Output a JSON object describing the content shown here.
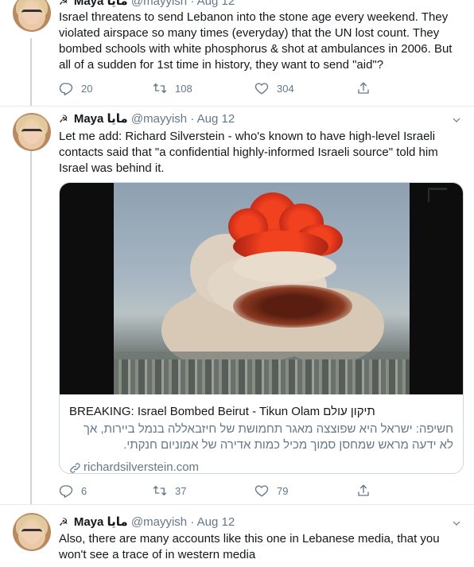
{
  "tweets": [
    {
      "flag": "☭",
      "display_name": "Maya مايا",
      "handle": "@mayyish",
      "separator": "·",
      "date": "Aug 12",
      "text": "Israel threatens to send Lebanon into the stone age every weekend. They violated airspace so many times (everyday) that the UN lost count. They bombed schools with white phosphorus & shot at ambulances in 2006. But all of a sudden for 1st time in history, they want to send \"aid\"?",
      "replies": "20",
      "retweets": "108",
      "likes": "304"
    },
    {
      "flag": "☭",
      "display_name": "Maya مايا",
      "handle": "@mayyish",
      "separator": "·",
      "date": "Aug 12",
      "text": "Let me add: Richard Silverstein - who's known to have high-level Israeli contacts said that  \"a confidential highly-informed Israeli source\" told him Israel was behind it.",
      "card": {
        "title": "BREAKING: Israel Bombed Beirut - Tikun Olam תיקון עולם",
        "description": "חשיפה: ישראל היא שפוצצה מאגר תחמושת של חיזבאללה בנמל ביירות, אך לא ידעה מראש שמחסן סמוך מכיל כמות אדירה של אמוניום חנקתי.",
        "link": "richardsilverstein.com"
      },
      "replies": "6",
      "retweets": "37",
      "likes": "79"
    },
    {
      "flag": "☭",
      "display_name": "Maya مايا",
      "handle": "@mayyish",
      "separator": "·",
      "date": "Aug 12",
      "text": "Also, there are many accounts like this one in Lebanese media, that you won't see a trace of in western media"
    }
  ],
  "icons": {
    "reply": "reply-icon",
    "retweet": "retweet-icon",
    "like": "like-icon",
    "share": "share-icon",
    "caret": "chevron-down-icon",
    "link": "link-icon"
  },
  "colors": {
    "text": "#14171a",
    "muted": "#657786",
    "border": "#ccd6dd",
    "divider": "#e6ecf0"
  }
}
